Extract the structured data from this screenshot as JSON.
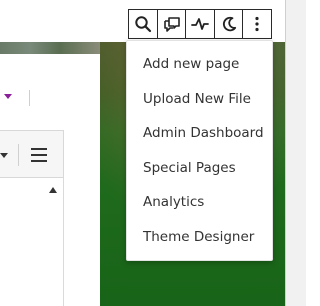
{
  "toolbar": {
    "buttons": [
      {
        "icon": "search-icon",
        "label": ""
      },
      {
        "icon": "chat-bubbles-icon",
        "label": ""
      },
      {
        "icon": "activity-icon",
        "label": ""
      },
      {
        "icon": "moon-icon",
        "label": ""
      },
      {
        "icon": "more-vertical-icon",
        "label": ""
      }
    ]
  },
  "menu": {
    "items": [
      {
        "label": "Add new page"
      },
      {
        "label": "Upload New File"
      },
      {
        "label": "Admin Dashboard"
      },
      {
        "label": "Special Pages"
      },
      {
        "label": "Analytics"
      },
      {
        "label": "Theme Designer"
      }
    ]
  },
  "colors": {
    "accent_purple": "#8a1f9a",
    "foliage_green": "#1f6a1c"
  }
}
